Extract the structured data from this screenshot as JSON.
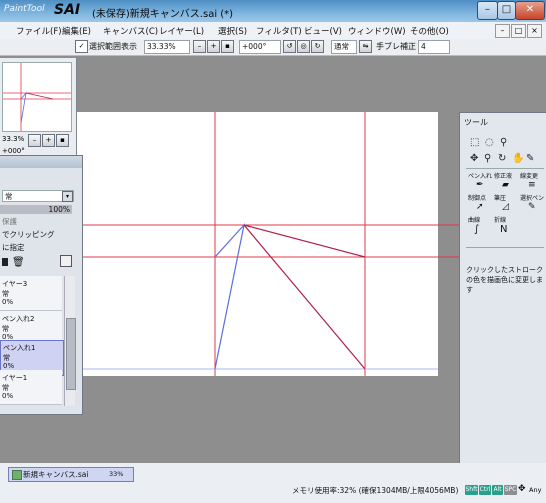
{
  "app": {
    "logo_small": "PaintTool",
    "logo_large": "SAI",
    "title": "(未保存)新規キャンバス.sai (*)"
  },
  "menu": [
    "ファイル(F)",
    "編集(E)",
    "キャンバス(C)",
    "レイヤー(L)",
    "選択(S)",
    "フィルタ(T)",
    "ビュー(V)",
    "ウィンドウ(W)",
    "その他(O)"
  ],
  "toolbar": {
    "selection_checkbox_label": "選択範囲表示",
    "zoom": "33.33%",
    "rotation": "+000°",
    "blend_mode": "通常",
    "stabilizer_label": "手ブレ補正",
    "stabilizer_value": "4"
  },
  "navigator": {
    "zoom": "33.3%",
    "rotation": "+000°"
  },
  "layer_panel": {
    "mode_value": "常",
    "opacity": "100%",
    "clipping_label": "でクリッピング",
    "reference_label": "に指定",
    "layers": [
      {
        "name": "イヤー3",
        "mode": "常",
        "opacity": "0%"
      },
      {
        "name": "ペン入れ2",
        "mode": "常",
        "opacity": "0%"
      },
      {
        "name": "ペン入れ1",
        "mode": "常",
        "opacity": "0%"
      },
      {
        "name": "イヤー1",
        "mode": "常",
        "opacity": "0%"
      }
    ]
  },
  "tool_panel": {
    "title": "ツール",
    "tools": [
      "ペン入れ",
      "修正液",
      "線変更",
      "制御点",
      "筆圧",
      "選択ペン",
      "曲線",
      "折線"
    ],
    "hint": "クリックしたストロークの色を描画色に変更します"
  },
  "status": {
    "tab_name": "新規キャンバス.sai",
    "tab_zoom": "33%",
    "memory": "メモリ使用率:32% (確保1304MB/上限4056MB)",
    "keys": [
      "Shft",
      "Ctrl",
      "Alt",
      "SPC"
    ],
    "any_label": "Any"
  },
  "colors": {
    "guide_red": "#e0384a",
    "stroke_blue": "#5a6ee0",
    "stroke_crimson": "#b01f4c",
    "title_bar": "#6aa6d8"
  }
}
